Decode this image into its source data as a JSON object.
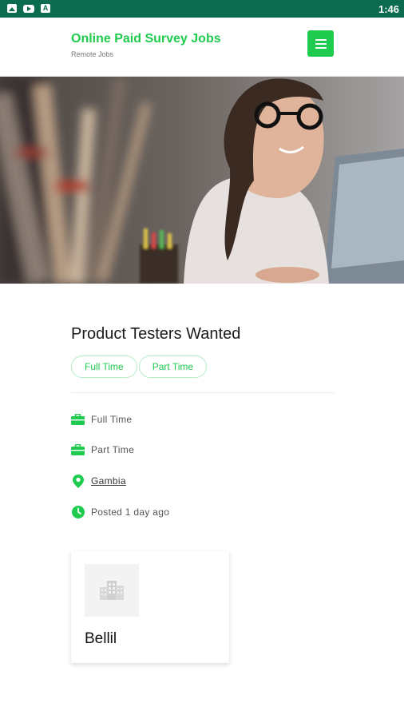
{
  "status_bar": {
    "time": "1:46",
    "icons": [
      "image-icon",
      "youtube-icon",
      "a-icon"
    ]
  },
  "header": {
    "title": "Online Paid Survey Jobs",
    "subtitle": "Remote Jobs",
    "menu_icon": "hamburger-menu-icon"
  },
  "hero": {
    "image": "woman-with-glasses-at-laptop"
  },
  "job": {
    "title": "Product Testers Wanted",
    "chips": [
      "Full Time",
      "Part Time"
    ],
    "meta": {
      "type_1": "Full Time",
      "type_2": "Part Time",
      "location": "Gambia",
      "posted": "Posted 1 day ago"
    }
  },
  "company": {
    "name": "Bellil",
    "logo_icon": "building-icon"
  },
  "colors": {
    "brand_green": "#1fcb4f",
    "status_bar": "#0b6b4f"
  }
}
